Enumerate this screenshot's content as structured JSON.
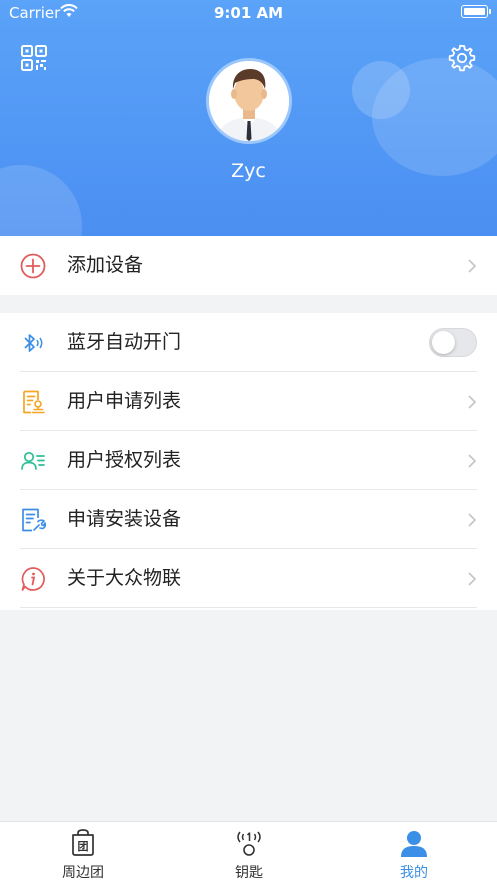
{
  "status_bar": {
    "carrier": "Carrier",
    "time": "9:01 AM"
  },
  "header": {
    "username": "Zyc",
    "left_icon": "qr-code-icon",
    "right_icon": "gear-icon"
  },
  "menu_top": [
    {
      "label": "添加设备",
      "icon": "add-circle-icon",
      "color": "#e25c5c"
    }
  ],
  "menu_main": [
    {
      "label": "蓝牙自动开门",
      "icon": "bluetooth-icon",
      "color": "#3b8fe6",
      "toggle": false
    },
    {
      "label": "用户申请列表",
      "icon": "application-list-icon",
      "color": "#f5a623"
    },
    {
      "label": "用户授权列表",
      "icon": "user-list-icon",
      "color": "#2cbf95"
    },
    {
      "label": "申请安装设备",
      "icon": "install-wrench-icon",
      "color": "#3b8fe6"
    },
    {
      "label": "关于大众物联",
      "icon": "info-icon",
      "color": "#e25c5c"
    }
  ],
  "tabbar": [
    {
      "label": "周边团",
      "icon": "group-bag-icon",
      "active": false
    },
    {
      "label": "钥匙",
      "icon": "key-signal-icon",
      "active": false
    },
    {
      "label": "我的",
      "icon": "person-icon",
      "active": true
    }
  ],
  "colors": {
    "header_top": "#5aa3f8",
    "header_bottom": "#4b8ff2",
    "active_tab": "#3b8fe6"
  }
}
